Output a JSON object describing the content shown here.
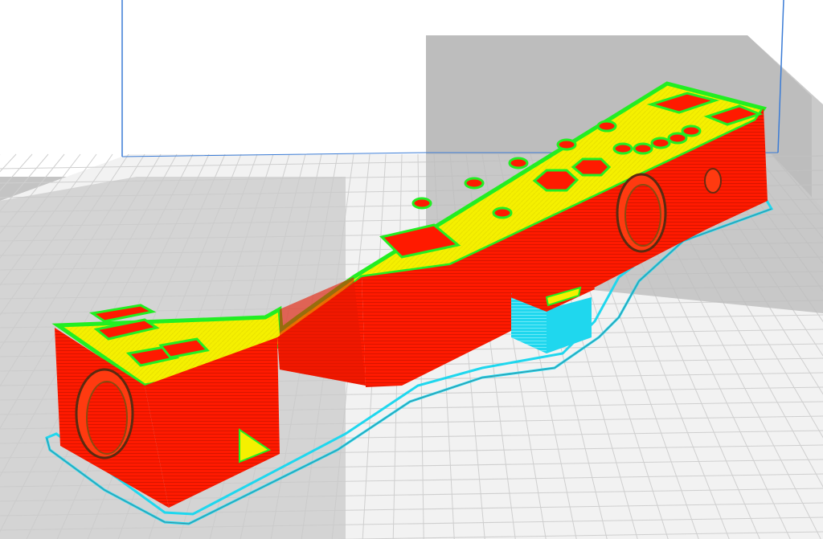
{
  "viewer": {
    "view": "layer-preview",
    "colors": {
      "background": "#ffffff",
      "build_plate": "#f2f2f2",
      "grid_line": "#c8c8c8",
      "disallowed_area": "#bebebe",
      "volume_edge": "#3a7bd5",
      "outer_wall": "#ff1a00",
      "inner_wall": "#22ee22",
      "top_bottom_skin": "#f5f000",
      "support": "#1fd7ee",
      "skirt": "#1fd7ee",
      "skirt_outline": "#3a8fa0",
      "infill_shadow": "#7a3a10"
    },
    "layers": [
      "skirt",
      "outer-wall",
      "inner-wall",
      "top-bottom-skin",
      "support"
    ]
  }
}
